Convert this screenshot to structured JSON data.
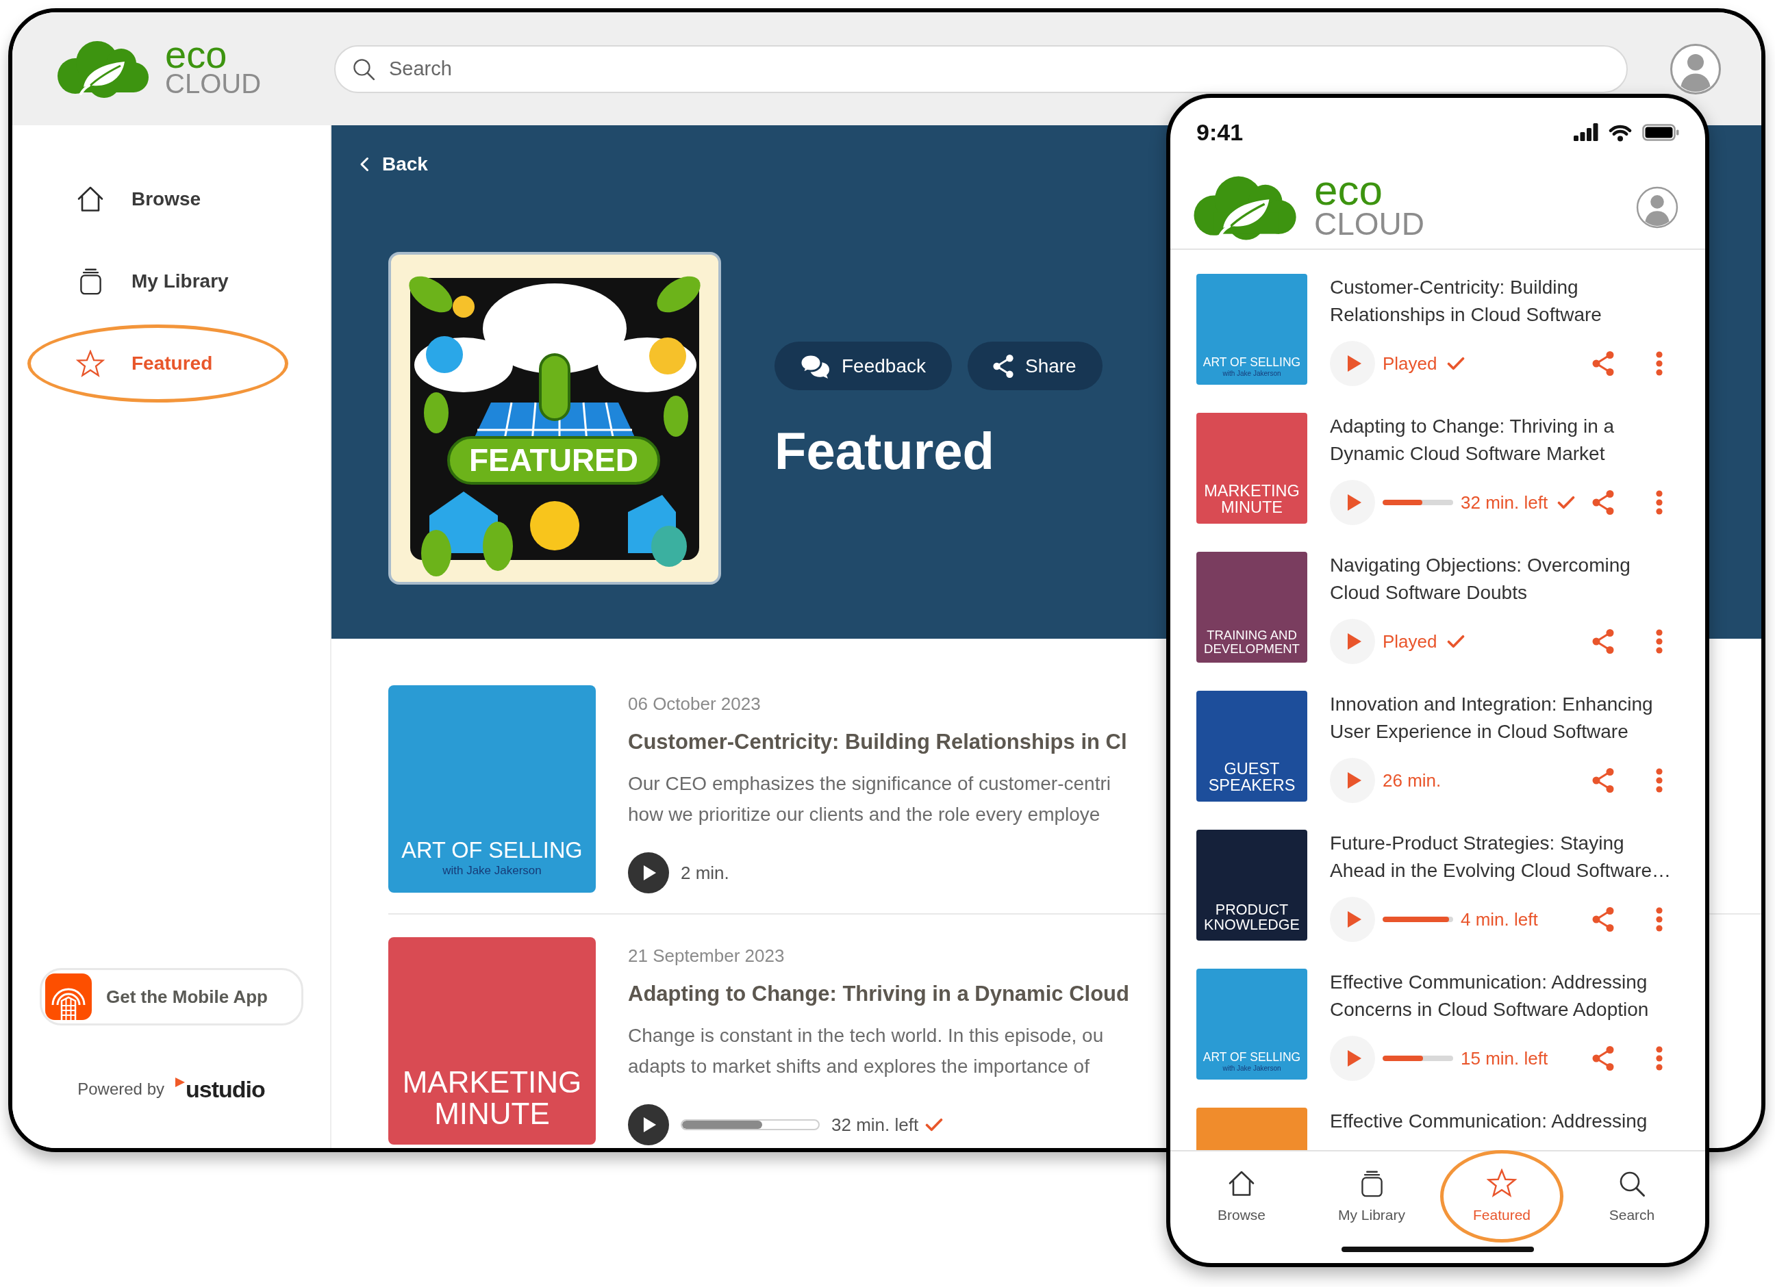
{
  "desktop": {
    "logo": {
      "lines": [
        "eco",
        "CLOUD"
      ]
    },
    "search": {
      "placeholder": "Search"
    },
    "sidebar": {
      "items": [
        {
          "label": "Browse",
          "selected": false,
          "circled": false
        },
        {
          "label": "My Library",
          "selected": false,
          "circled": false
        },
        {
          "label": "Featured",
          "selected": true,
          "circled": true
        }
      ],
      "app_button": {
        "label": "Get the Mobile App"
      },
      "powered_by": {
        "text": "Powered by",
        "brand": "ustudio"
      }
    },
    "banner": {
      "back": "Back",
      "artwork": {
        "label": "FEATURED"
      },
      "buttons": [
        {
          "label": "Feedback"
        },
        {
          "label": "Share"
        }
      ],
      "title": "Featured"
    },
    "episodes": [
      {
        "cover": {
          "title_lines": [
            "ART OF SELLING"
          ],
          "subtitle": "with Jake Jakerson",
          "color": "#2a9bd4"
        },
        "date": "06 October 2023",
        "title": "Customer-Centricity: Building Relationships in Cl",
        "description_lines": [
          "Our CEO emphasizes the significance of customer-centri",
          "how we prioritize our clients and the role every employe"
        ],
        "kind": "plain",
        "status": "2 min.",
        "played": false
      },
      {
        "cover": {
          "title_lines": [
            "MARKETING",
            "MINUTE"
          ],
          "color": "#d94b53"
        },
        "date": "21 September 2023",
        "title": "Adapting to Change: Thriving in a Dynamic Cloud",
        "description_lines": [
          "Change is constant in the tech world. In this episode, ou",
          "adapts to market shifts and explores the importance of"
        ],
        "kind": "progress",
        "level": 0.59,
        "status": "32 min. left",
        "played": true
      }
    ]
  },
  "phone": {
    "status_bar": {
      "time": "9:41"
    },
    "logo": {
      "lines": [
        "eco",
        "CLOUD"
      ]
    },
    "episodes": [
      {
        "cover": {
          "title_lines": [
            "ART OF SELLING"
          ],
          "subtitle": "with Jake Jakerson",
          "color": "#2a9bd4"
        },
        "title_lines": [
          "Customer-Centricity: Building",
          "Relationships in Cloud Software"
        ],
        "kind": "plain",
        "status": "Played",
        "played": true
      },
      {
        "cover": {
          "title_lines": [
            "MARKETING",
            "MINUTE"
          ],
          "color": "#d94b53"
        },
        "title_lines": [
          "Adapting to Change: Thriving in a",
          "Dynamic Cloud Software Market"
        ],
        "kind": "progress",
        "level": 0.56,
        "status": "32 min. left",
        "played": true
      },
      {
        "cover": {
          "title_lines": [
            "TRAINING AND",
            "DEVELOPMENT"
          ],
          "color": "#7a3d5f"
        },
        "title_lines": [
          "Navigating Objections: Overcoming",
          "Cloud Software Doubts"
        ],
        "kind": "plain",
        "status": "Played",
        "played": true
      },
      {
        "cover": {
          "title_lines": [
            "GUEST",
            "SPEAKERS"
          ],
          "color": "#1d4e9b"
        },
        "title_lines": [
          "Innovation and Integration: Enhancing",
          "User Experience in Cloud Software"
        ],
        "kind": "plain",
        "status": "26 min.",
        "played": false
      },
      {
        "cover": {
          "title_lines": [
            "PRODUCT",
            "KNOWLEDGE"
          ],
          "color": "#15213a"
        },
        "title_lines": [
          "Future-Product Strategies: Staying",
          "Ahead in the Evolving Cloud Software…"
        ],
        "kind": "progress",
        "level": 0.94,
        "status": "4 min. left",
        "played": false
      },
      {
        "cover": {
          "title_lines": [
            "ART OF SELLING"
          ],
          "subtitle": "with Jake Jakerson",
          "color": "#2a9bd4"
        },
        "title_lines": [
          "Effective Communication: Addressing",
          "Concerns in Cloud Software Adoption"
        ],
        "kind": "progress",
        "level": 0.57,
        "status": "15 min. left",
        "played": false
      },
      {
        "cover": {
          "color": "#f08c2c"
        },
        "title_lines": [
          "Effective Communication: Addressing"
        ]
      }
    ],
    "tabs": [
      {
        "label": "Browse",
        "selected": false,
        "circled": false
      },
      {
        "label": "My Library",
        "selected": false,
        "circled": false
      },
      {
        "label": "Featured",
        "selected": true,
        "circled": true
      },
      {
        "label": "Search",
        "selected": false,
        "circled": false
      }
    ]
  }
}
